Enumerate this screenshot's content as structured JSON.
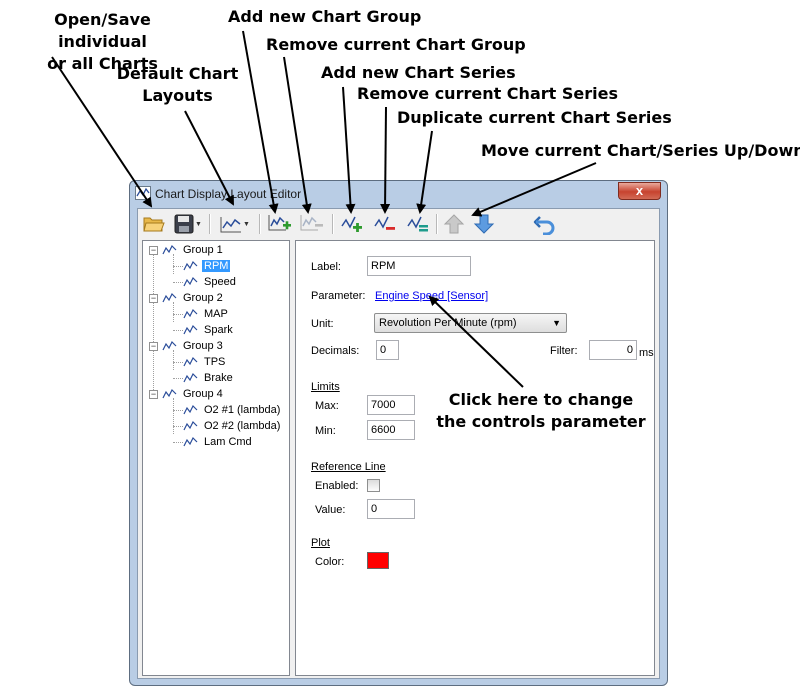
{
  "annotations": {
    "open_save": "Open/Save individual\nor all Charts",
    "default_layouts": "Default Chart\nLayouts",
    "add_group": "Add new Chart Group",
    "remove_group": "Remove current Chart Group",
    "add_series": "Add new Chart Series",
    "remove_series": "Remove current Chart Series",
    "duplicate_series": "Duplicate current Chart Series",
    "move_up_down": "Move current Chart/Series Up/Down",
    "click_here": "Click here to change\nthe controls parameter"
  },
  "window": {
    "title": "Chart Display Layout Editor",
    "close_label": "x"
  },
  "toolbar": {
    "buttons": [
      "open-icon",
      "save-icon",
      "default-layouts-icon",
      "add-group-icon",
      "remove-group-icon",
      "add-series-icon",
      "remove-series-icon",
      "duplicate-series-icon",
      "move-up-icon",
      "move-down-icon",
      "undo-icon"
    ]
  },
  "tree": {
    "groups": [
      {
        "label": "Group 1",
        "series": [
          "RPM",
          "Speed"
        ]
      },
      {
        "label": "Group 2",
        "series": [
          "MAP",
          "Spark"
        ]
      },
      {
        "label": "Group 3",
        "series": [
          "TPS",
          "Brake"
        ]
      },
      {
        "label": "Group 4",
        "series": [
          "O2 #1 (lambda)",
          "O2 #2 (lambda)",
          "Lam Cmd"
        ]
      }
    ],
    "selected": "RPM",
    "expander_symbol": "−"
  },
  "properties": {
    "label": {
      "caption": "Label:",
      "value": "RPM"
    },
    "parameter": {
      "caption": "Parameter:",
      "value": "Engine Speed [Sensor]"
    },
    "unit": {
      "caption": "Unit:",
      "value": "Revolution Per Minute (rpm)"
    },
    "decimals": {
      "caption": "Decimals:",
      "value": "0"
    },
    "filter": {
      "caption": "Filter:",
      "value": "0",
      "unit": "ms"
    },
    "limits": {
      "header": "Limits",
      "max_caption": "Max:",
      "max_value": "7000",
      "min_caption": "Min:",
      "min_value": "6600"
    },
    "reference_line": {
      "header": "Reference Line",
      "enabled_caption": "Enabled:",
      "enabled": false,
      "value_caption": "Value:",
      "value": "0"
    },
    "plot": {
      "header": "Plot",
      "color_caption": "Color:",
      "color": "#ff0000"
    }
  }
}
